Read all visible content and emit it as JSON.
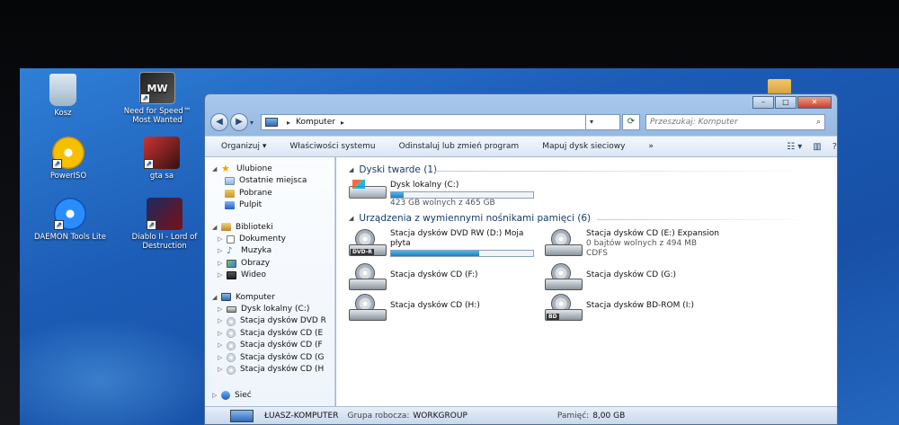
{
  "desktop": {
    "icons": [
      {
        "label": "Kosz",
        "icon": "recycle-bin-icon"
      },
      {
        "label": "Need for Speed™\nMost Wanted",
        "icon": "nfs-icon",
        "badge": "MW"
      },
      {
        "label": "PowerISO",
        "icon": "poweriso-icon"
      },
      {
        "label": "gta sa",
        "icon": "gta-icon"
      },
      {
        "label": "DAEMON Tools Lite",
        "icon": "daemon-tools-icon"
      },
      {
        "label": "Diablo II - Lord of\nDestruction",
        "icon": "diablo-icon"
      }
    ]
  },
  "window": {
    "caption": {
      "minimize": "–",
      "maximize": "□",
      "close": "✕"
    },
    "address": {
      "root": "Komputer",
      "separator": "▸"
    },
    "search": {
      "placeholder": "Przeszukaj: Komputer"
    },
    "toolbar": {
      "organize": "Organizuj ▾",
      "properties": "Właściwości systemu",
      "uninstall": "Odinstaluj lub zmień program",
      "map_drive": "Mapuj dysk sieciowy",
      "more": "»"
    },
    "nav": {
      "favorites": {
        "title": "Ulubione",
        "items": [
          "Ostatnie miejsca",
          "Pobrane",
          "Pulpit"
        ]
      },
      "libraries": {
        "title": "Biblioteki",
        "items": [
          "Dokumenty",
          "Muzyka",
          "Obrazy",
          "Wideo"
        ]
      },
      "computer": {
        "title": "Komputer",
        "items": [
          "Dysk lokalny (C:)",
          "Stacja dysków DVD R",
          "Stacja dysków CD (E",
          "Stacja dysków CD (F",
          "Stacja dysków CD (G",
          "Stacja dysków CD (H"
        ]
      },
      "network": {
        "title": "Sieć"
      }
    },
    "content": {
      "hard_drives": {
        "header": "Dyski twarde (1)",
        "items": [
          {
            "name": "Dysk lokalny (C:)",
            "free": "423 GB wolnych z 465 GB",
            "used_fraction": 0.09
          }
        ]
      },
      "removable": {
        "header": "Urządzenia z wymiennymi nośnikami pamięci (6)",
        "items": [
          {
            "name": "Stacja dysków DVD RW (D:) Moja",
            "name2": "płyta",
            "badge": "DVD-R",
            "used_fraction": 0.62
          },
          {
            "name": "Stacja dysków CD (E:) Expansion",
            "free": "0 bajtów wolnych z 494 MB",
            "fs": "CDFS"
          },
          {
            "name": "Stacja dysków CD (F:)"
          },
          {
            "name": "Stacja dysków CD (G:)"
          },
          {
            "name": "Stacja dysków CD (H:)"
          },
          {
            "name": "Stacja dysków BD-ROM (I:)",
            "badge": "BD"
          }
        ]
      }
    },
    "status": {
      "computer_name": "ŁUASZ-KOMPUTER",
      "workgroup_label": "Grupa robocza:",
      "workgroup": "WORKGROUP",
      "memory_label": "Pamięć:",
      "memory": "8,00 GB"
    }
  }
}
